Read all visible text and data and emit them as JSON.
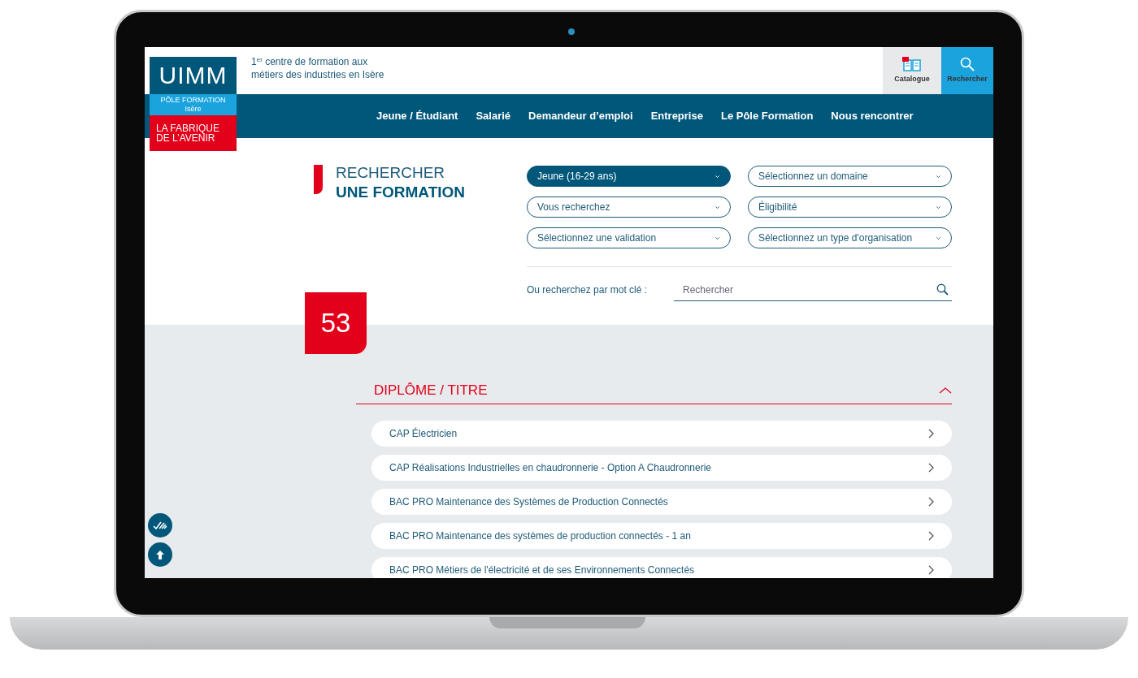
{
  "header": {
    "logo": {
      "brand": "UIMM",
      "subtitle": "PÔLE FORMATION",
      "region": "Isère",
      "slogan": "LA FABRIQUE DE L’AVENIR"
    },
    "tagline": "1$^{er}$ centre de formation aux métiers des industries en Isère",
    "actions": [
      {
        "kind": "catalogue",
        "label": "Catalogue"
      },
      {
        "kind": "search",
        "label": "Rechercher"
      }
    ]
  },
  "nav": [
    "Jeune / Étudiant",
    "Salarié",
    "Demandeur d’emploi",
    "Entreprise",
    "Le Pôle Formation",
    "Nous rencontrer"
  ],
  "search": {
    "title_light": "RECHERCHER",
    "title_bold": "UNE FORMATION",
    "filters": [
      {
        "text": "Jeune (16-29 ans)",
        "filled": true
      },
      {
        "text": "Sélectionnez un domaine",
        "filled": false
      },
      {
        "text": "Vous recherchez",
        "filled": false
      },
      {
        "text": "Éligibilité",
        "filled": false
      },
      {
        "text": "Sélectionnez une validation",
        "filled": false
      },
      {
        "text": "Sélectionnez un type d'organisation",
        "filled": false
      }
    ],
    "keyword_label": "Ou recherchez par mot clé :",
    "keyword_placeholder": "Rechercher"
  },
  "results": {
    "count": "53",
    "section": {
      "title": "DIPLÔME / TITRE",
      "expanded": true,
      "items": [
        "CAP Électricien",
        "CAP Réalisations Industrielles en chaudronnerie - Option A Chaudronnerie",
        "BAC PRO Maintenance des Systèmes de Production Connectés",
        "BAC PRO Maintenance des systèmes de production connectés - 1 an",
        "BAC PRO Métiers de l'électricité et de ses Environnements Connectés"
      ]
    }
  }
}
